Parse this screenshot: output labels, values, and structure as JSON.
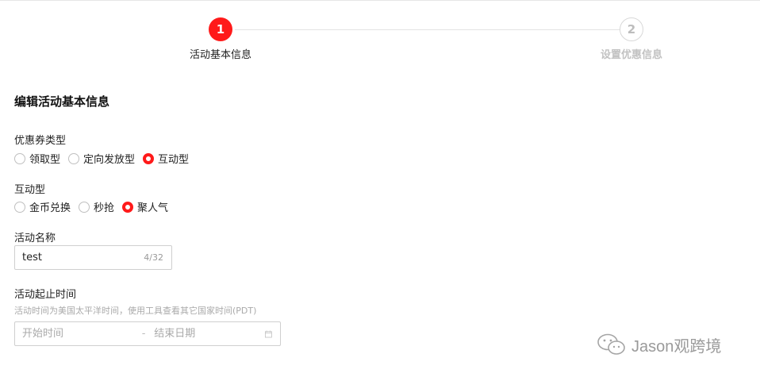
{
  "steps": [
    {
      "number": "1",
      "label": "活动基本信息",
      "state": "active"
    },
    {
      "number": "2",
      "label": "设置优惠信息",
      "state": "inactive"
    }
  ],
  "section_title": "编辑活动基本信息",
  "coupon_type": {
    "label": "优惠券类型",
    "options": [
      "领取型",
      "定向发放型",
      "互动型"
    ],
    "selected": "互动型"
  },
  "interaction_type": {
    "label": "互动型",
    "options": [
      "金币兑换",
      "秒抢",
      "聚人气"
    ],
    "selected": "聚人气"
  },
  "activity_name": {
    "label": "活动名称",
    "value": "test",
    "counter": "4/32"
  },
  "activity_time": {
    "label": "活动起止时间",
    "hint": "活动时间为美国太平洋时间，使用工具查看其它国家时间(PDT)",
    "start_placeholder": "开始时间",
    "separator": "-",
    "end_placeholder": "结束日期"
  },
  "watermark": {
    "text": "Jason观跨境"
  },
  "colors": {
    "accent": "#ff1a1a",
    "border": "#cfcfcf",
    "muted": "#aaaaaa"
  }
}
